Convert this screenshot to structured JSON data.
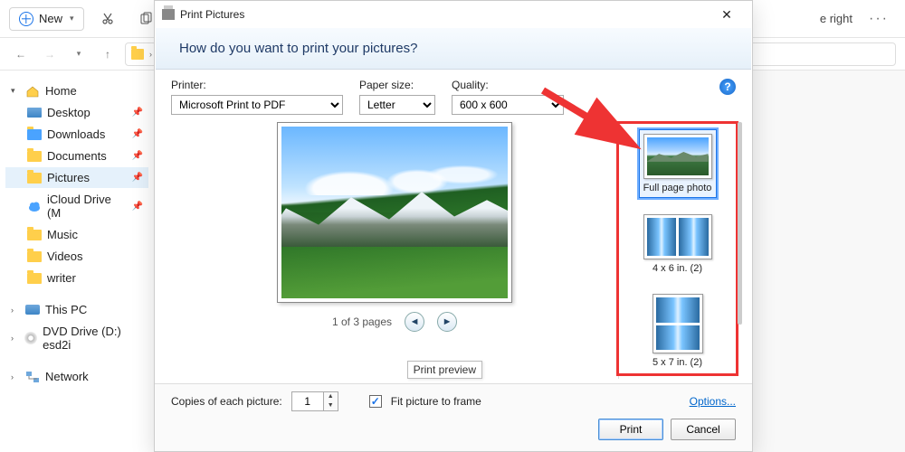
{
  "toolbar": {
    "new_label": "New",
    "right_label": "e right"
  },
  "sidebar": {
    "home": "Home",
    "items": [
      {
        "label": "Desktop"
      },
      {
        "label": "Downloads"
      },
      {
        "label": "Documents"
      },
      {
        "label": "Pictures"
      },
      {
        "label": "iCloud Drive (M"
      },
      {
        "label": "Music"
      },
      {
        "label": "Videos"
      },
      {
        "label": "writer"
      }
    ],
    "this_pc": "This PC",
    "dvd": "DVD Drive (D:) esd2i",
    "network": "Network"
  },
  "dialog": {
    "title": "Print Pictures",
    "heading": "How do you want to print your pictures?",
    "printer_label": "Printer:",
    "printer_value": "Microsoft Print to PDF",
    "paper_label": "Paper size:",
    "paper_value": "Letter",
    "quality_label": "Quality:",
    "quality_value": "600 x 600",
    "pager_text": "1 of 3 pages",
    "print_preview_tip": "Print preview",
    "layouts": [
      {
        "label": "Full page photo"
      },
      {
        "label": "4 x 6 in. (2)"
      },
      {
        "label": "5 x 7 in. (2)"
      }
    ],
    "copies_label": "Copies of each picture:",
    "copies_value": "1",
    "fit_label": "Fit picture to frame",
    "options_link": "Options...",
    "print_btn": "Print",
    "cancel_btn": "Cancel"
  }
}
